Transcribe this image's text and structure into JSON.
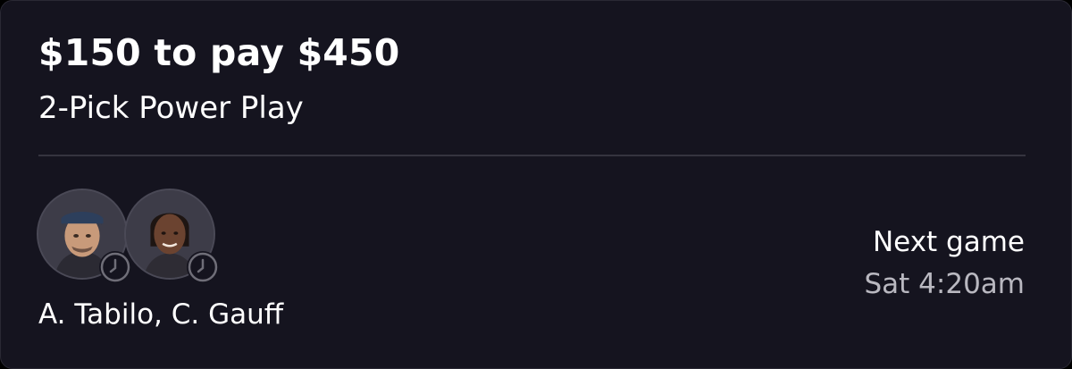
{
  "entry": {
    "title": "$150 to pay $450",
    "subtitle": "2-Pick Power Play"
  },
  "players": {
    "names": "A. Tabilo, C. Gauff",
    "avatars": [
      {
        "icon": "player-avatar-tabilo",
        "status_icon": "clock-icon"
      },
      {
        "icon": "player-avatar-gauff",
        "status_icon": "clock-icon"
      }
    ]
  },
  "next_game": {
    "label": "Next game",
    "time": "Sat 4:20am"
  },
  "colors": {
    "card_background": "#15141f",
    "divider": "#35343f",
    "primary_text": "#ffffff",
    "secondary_text": "#b9b8c0"
  }
}
